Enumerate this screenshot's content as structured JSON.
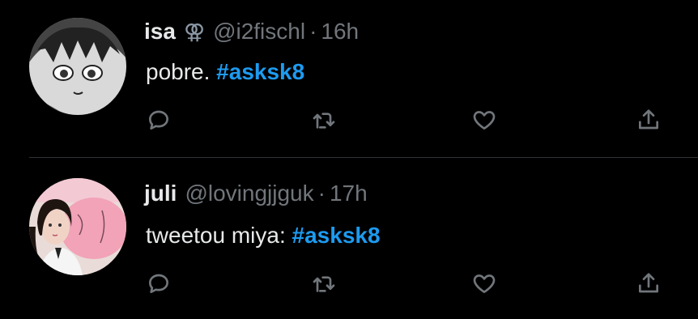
{
  "tweets": [
    {
      "name": "isa",
      "badge": "⚢",
      "handle": "@i2fischl",
      "separator": "·",
      "time": "16h",
      "text_before": "pobre. ",
      "hashtag": "#asksk8",
      "avatar": "manga-character-avatar"
    },
    {
      "name": "juli",
      "badge": "",
      "handle": "@lovingjjguk",
      "separator": "·",
      "time": "17h",
      "text_before": "tweetou miya: ",
      "hashtag": "#asksk8",
      "avatar": "photo-avatar-pink-balloon"
    }
  ],
  "actions": [
    "reply-icon",
    "retweet-icon",
    "like-icon",
    "share-icon"
  ],
  "colors": {
    "background": "#000000",
    "text": "#e7e9ea",
    "muted": "#71767b",
    "hashtag": "#1d9bf0",
    "divider": "#2f3336"
  }
}
